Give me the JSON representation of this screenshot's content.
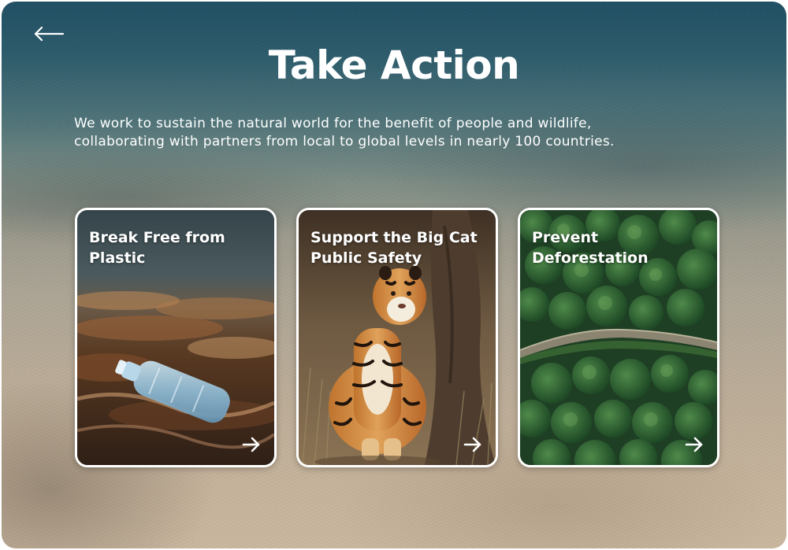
{
  "page": {
    "title": "Take Action",
    "intro_line_1": "We work to sustain the natural world for the benefit of people and wildlife,",
    "intro_line_2": "collaborating with partners from local to global levels in nearly 100 countries."
  },
  "navigation": {
    "back_icon": "arrow-left-icon"
  },
  "cards": [
    {
      "title_line_1": "Break Free from",
      "title_line_2": "Plastic",
      "image": "plastic-bottle-on-seaweed-photo",
      "arrow_icon": "arrow-right-icon"
    },
    {
      "title_line_1": "Support the Big Cat",
      "title_line_2": "Public Safety",
      "image": "tiger-sitting-photo",
      "arrow_icon": "arrow-right-icon"
    },
    {
      "title_line_1": "Prevent",
      "title_line_2": "Deforestation",
      "image": "aerial-forest-photo",
      "arrow_icon": "arrow-right-icon"
    }
  ],
  "colors": {
    "text": "#ffffff",
    "ocean_top": "#1f4e63",
    "sand": "#c9b69e",
    "card_border": "#ffffff"
  }
}
